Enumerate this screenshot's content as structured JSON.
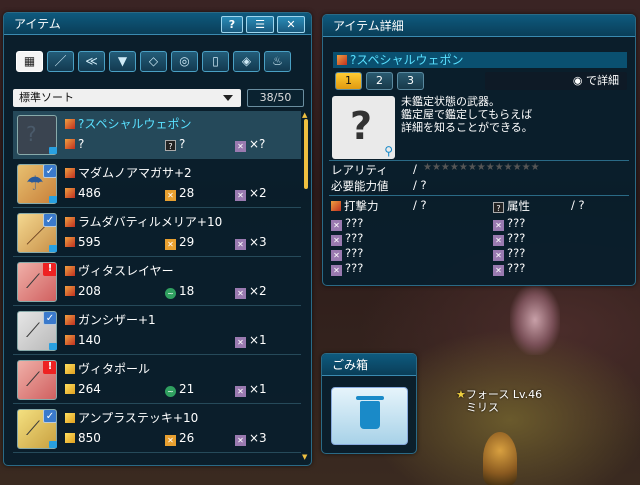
{
  "item_panel": {
    "title": "アイテム",
    "help_label": "?",
    "close_label": "✕",
    "categories": [
      "all",
      "sword",
      "wired-lance",
      "armor",
      "partisan",
      "twin-dagger",
      "rod",
      "rifle",
      "bag"
    ],
    "sort_label": "標準ソート",
    "count": "38/50",
    "items": [
      {
        "name": "?スペシャルウェポン",
        "attack": "?",
        "element": "?",
        "qty": "×?",
        "icon": "unknown-weapon",
        "badge": "none",
        "highlight": true
      },
      {
        "name": "マダムノアマガサ+2",
        "attack": "486",
        "element": "28",
        "qty": "×2",
        "icon": "umbrella",
        "badge": "check"
      },
      {
        "name": "ラムダバティルメリア+10",
        "attack": "595",
        "element": "29",
        "qty": "×3",
        "icon": "partisan",
        "badge": "check"
      },
      {
        "name": "ヴィタスレイヤー",
        "attack": "208",
        "element": "18",
        "qty": "×2",
        "icon": "slayer",
        "badge": "exclaim"
      },
      {
        "name": "ガンシザー+1",
        "attack": "140",
        "element": "",
        "qty": "×1",
        "icon": "gunslash",
        "badge": "check"
      },
      {
        "name": "ヴィタポール",
        "attack": "264",
        "element": "21",
        "qty": "×1",
        "icon": "pole",
        "badge": "exclaim"
      },
      {
        "name": "アンプラステッキ+10",
        "attack": "850",
        "element": "26",
        "qty": "×3",
        "icon": "stick",
        "badge": "check"
      }
    ]
  },
  "detail_panel": {
    "title": "アイテム詳細",
    "item_name": "?スペシャルウェポン",
    "tabs": [
      "1",
      "2",
      "3"
    ],
    "detail_button": "で詳細",
    "description_lines": [
      "未鑑定状態の武器。",
      "鑑定屋で鑑定してもらえば",
      "詳細を知ることができる。"
    ],
    "rarity_label": "レアリティ",
    "rarity_sep": "/",
    "requirement_label": "必要能力値",
    "requirement_value": "/ ?",
    "attack_label": "打撃力",
    "attack_value": "/ ?",
    "attribute_label": "属性",
    "attribute_value": "/ ?",
    "unknown_rows": [
      "???",
      "???",
      "???",
      "???"
    ],
    "unknown_rows_right": [
      "???",
      "???",
      "???",
      "???"
    ]
  },
  "trash_panel": {
    "title": "ごみ箱"
  },
  "player": {
    "class_level": "フォース Lv.46",
    "name": "ミリス"
  }
}
